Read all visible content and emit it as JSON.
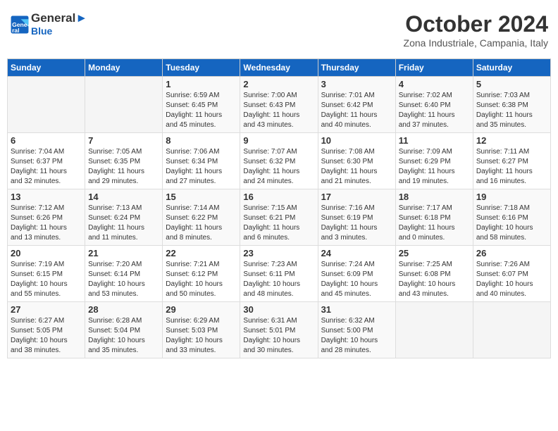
{
  "header": {
    "logo_line1": "General",
    "logo_line2": "Blue",
    "month": "October 2024",
    "location": "Zona Industriale, Campania, Italy"
  },
  "weekdays": [
    "Sunday",
    "Monday",
    "Tuesday",
    "Wednesday",
    "Thursday",
    "Friday",
    "Saturday"
  ],
  "weeks": [
    [
      {
        "day": "",
        "info": ""
      },
      {
        "day": "",
        "info": ""
      },
      {
        "day": "1",
        "info": "Sunrise: 6:59 AM\nSunset: 6:45 PM\nDaylight: 11 hours\nand 45 minutes."
      },
      {
        "day": "2",
        "info": "Sunrise: 7:00 AM\nSunset: 6:43 PM\nDaylight: 11 hours\nand 43 minutes."
      },
      {
        "day": "3",
        "info": "Sunrise: 7:01 AM\nSunset: 6:42 PM\nDaylight: 11 hours\nand 40 minutes."
      },
      {
        "day": "4",
        "info": "Sunrise: 7:02 AM\nSunset: 6:40 PM\nDaylight: 11 hours\nand 37 minutes."
      },
      {
        "day": "5",
        "info": "Sunrise: 7:03 AM\nSunset: 6:38 PM\nDaylight: 11 hours\nand 35 minutes."
      }
    ],
    [
      {
        "day": "6",
        "info": "Sunrise: 7:04 AM\nSunset: 6:37 PM\nDaylight: 11 hours\nand 32 minutes."
      },
      {
        "day": "7",
        "info": "Sunrise: 7:05 AM\nSunset: 6:35 PM\nDaylight: 11 hours\nand 29 minutes."
      },
      {
        "day": "8",
        "info": "Sunrise: 7:06 AM\nSunset: 6:34 PM\nDaylight: 11 hours\nand 27 minutes."
      },
      {
        "day": "9",
        "info": "Sunrise: 7:07 AM\nSunset: 6:32 PM\nDaylight: 11 hours\nand 24 minutes."
      },
      {
        "day": "10",
        "info": "Sunrise: 7:08 AM\nSunset: 6:30 PM\nDaylight: 11 hours\nand 21 minutes."
      },
      {
        "day": "11",
        "info": "Sunrise: 7:09 AM\nSunset: 6:29 PM\nDaylight: 11 hours\nand 19 minutes."
      },
      {
        "day": "12",
        "info": "Sunrise: 7:11 AM\nSunset: 6:27 PM\nDaylight: 11 hours\nand 16 minutes."
      }
    ],
    [
      {
        "day": "13",
        "info": "Sunrise: 7:12 AM\nSunset: 6:26 PM\nDaylight: 11 hours\nand 13 minutes."
      },
      {
        "day": "14",
        "info": "Sunrise: 7:13 AM\nSunset: 6:24 PM\nDaylight: 11 hours\nand 11 minutes."
      },
      {
        "day": "15",
        "info": "Sunrise: 7:14 AM\nSunset: 6:22 PM\nDaylight: 11 hours\nand 8 minutes."
      },
      {
        "day": "16",
        "info": "Sunrise: 7:15 AM\nSunset: 6:21 PM\nDaylight: 11 hours\nand 6 minutes."
      },
      {
        "day": "17",
        "info": "Sunrise: 7:16 AM\nSunset: 6:19 PM\nDaylight: 11 hours\nand 3 minutes."
      },
      {
        "day": "18",
        "info": "Sunrise: 7:17 AM\nSunset: 6:18 PM\nDaylight: 11 hours\nand 0 minutes."
      },
      {
        "day": "19",
        "info": "Sunrise: 7:18 AM\nSunset: 6:16 PM\nDaylight: 10 hours\nand 58 minutes."
      }
    ],
    [
      {
        "day": "20",
        "info": "Sunrise: 7:19 AM\nSunset: 6:15 PM\nDaylight: 10 hours\nand 55 minutes."
      },
      {
        "day": "21",
        "info": "Sunrise: 7:20 AM\nSunset: 6:14 PM\nDaylight: 10 hours\nand 53 minutes."
      },
      {
        "day": "22",
        "info": "Sunrise: 7:21 AM\nSunset: 6:12 PM\nDaylight: 10 hours\nand 50 minutes."
      },
      {
        "day": "23",
        "info": "Sunrise: 7:23 AM\nSunset: 6:11 PM\nDaylight: 10 hours\nand 48 minutes."
      },
      {
        "day": "24",
        "info": "Sunrise: 7:24 AM\nSunset: 6:09 PM\nDaylight: 10 hours\nand 45 minutes."
      },
      {
        "day": "25",
        "info": "Sunrise: 7:25 AM\nSunset: 6:08 PM\nDaylight: 10 hours\nand 43 minutes."
      },
      {
        "day": "26",
        "info": "Sunrise: 7:26 AM\nSunset: 6:07 PM\nDaylight: 10 hours\nand 40 minutes."
      }
    ],
    [
      {
        "day": "27",
        "info": "Sunrise: 6:27 AM\nSunset: 5:05 PM\nDaylight: 10 hours\nand 38 minutes."
      },
      {
        "day": "28",
        "info": "Sunrise: 6:28 AM\nSunset: 5:04 PM\nDaylight: 10 hours\nand 35 minutes."
      },
      {
        "day": "29",
        "info": "Sunrise: 6:29 AM\nSunset: 5:03 PM\nDaylight: 10 hours\nand 33 minutes."
      },
      {
        "day": "30",
        "info": "Sunrise: 6:31 AM\nSunset: 5:01 PM\nDaylight: 10 hours\nand 30 minutes."
      },
      {
        "day": "31",
        "info": "Sunrise: 6:32 AM\nSunset: 5:00 PM\nDaylight: 10 hours\nand 28 minutes."
      },
      {
        "day": "",
        "info": ""
      },
      {
        "day": "",
        "info": ""
      }
    ]
  ]
}
